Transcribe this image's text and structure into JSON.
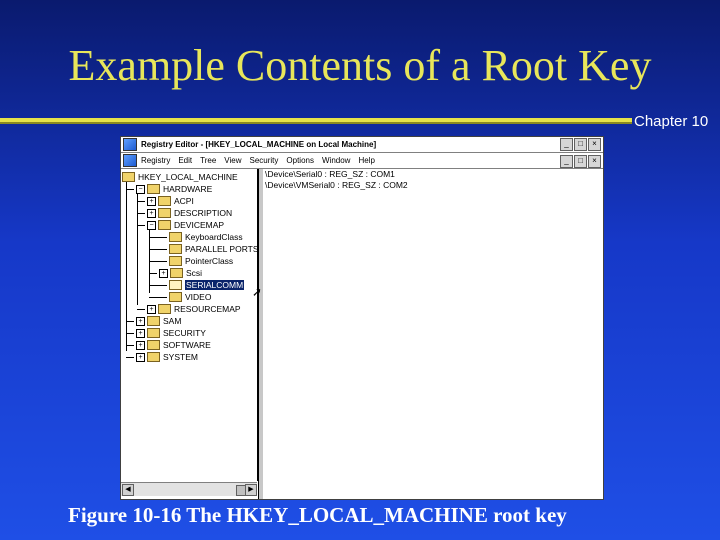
{
  "slide": {
    "title": "Example Contents of a Root Key",
    "chapter": "Chapter 10",
    "caption": "Figure 10-16  The HKEY_LOCAL_MACHINE root key"
  },
  "window": {
    "title": "Registry Editor - [HKEY_LOCAL_MACHINE on Local Machine]",
    "menu": [
      "Registry",
      "Edit",
      "Tree",
      "View",
      "Security",
      "Options",
      "Window",
      "Help"
    ],
    "controls": [
      "_",
      "□",
      "×"
    ]
  },
  "tree": {
    "root": "HKEY_LOCAL_MACHINE",
    "nodes": [
      {
        "label": "HARDWARE",
        "expander": "−"
      },
      {
        "label": "ACPI",
        "expander": "+"
      },
      {
        "label": "DESCRIPTION",
        "expander": "+"
      },
      {
        "label": "DEVICEMAP",
        "expander": "−"
      },
      {
        "label": "KeyboardClass",
        "expander": ""
      },
      {
        "label": "PARALLEL PORTS",
        "expander": ""
      },
      {
        "label": "PointerClass",
        "expander": ""
      },
      {
        "label": "Scsi",
        "expander": "+"
      },
      {
        "label": "SERIALCOMM",
        "expander": ""
      },
      {
        "label": "VIDEO",
        "expander": ""
      },
      {
        "label": "RESOURCEMAP",
        "expander": "+"
      },
      {
        "label": "SAM",
        "expander": "+"
      },
      {
        "label": "SECURITY",
        "expander": "+"
      },
      {
        "label": "SOFTWARE",
        "expander": "+"
      },
      {
        "label": "SYSTEM",
        "expander": "+"
      }
    ]
  },
  "values": [
    "\\Device\\Serial0 : REG_SZ : COM1",
    "\\Device\\VMSerial0 : REG_SZ : COM2"
  ]
}
